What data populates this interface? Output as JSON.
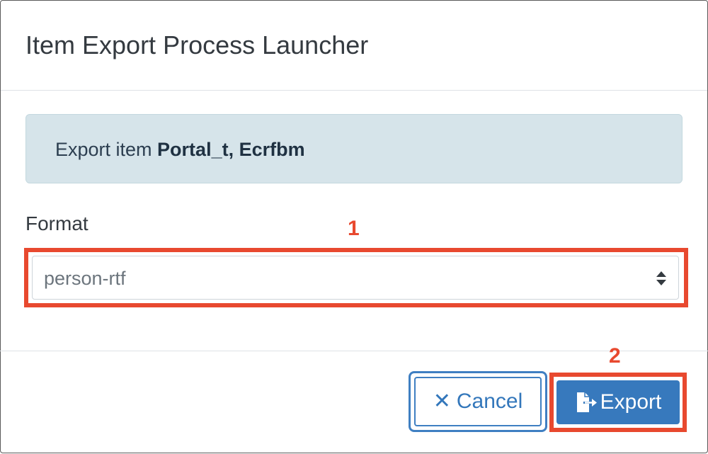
{
  "dialog": {
    "title": "Item Export Process Launcher"
  },
  "alert": {
    "prefix": "Export item ",
    "item_name": "Portal_t, Ecrfbm"
  },
  "format": {
    "label": "Format",
    "selected_value": "person-rtf"
  },
  "annotations": {
    "step1": "1",
    "step2": "2",
    "highlight_color": "#e8492f"
  },
  "footer": {
    "cancel_label": "Cancel",
    "export_label": "Export"
  },
  "colors": {
    "primary": "#3779bd",
    "alert_bg": "#d6e4ea",
    "title_text": "#343a40"
  }
}
